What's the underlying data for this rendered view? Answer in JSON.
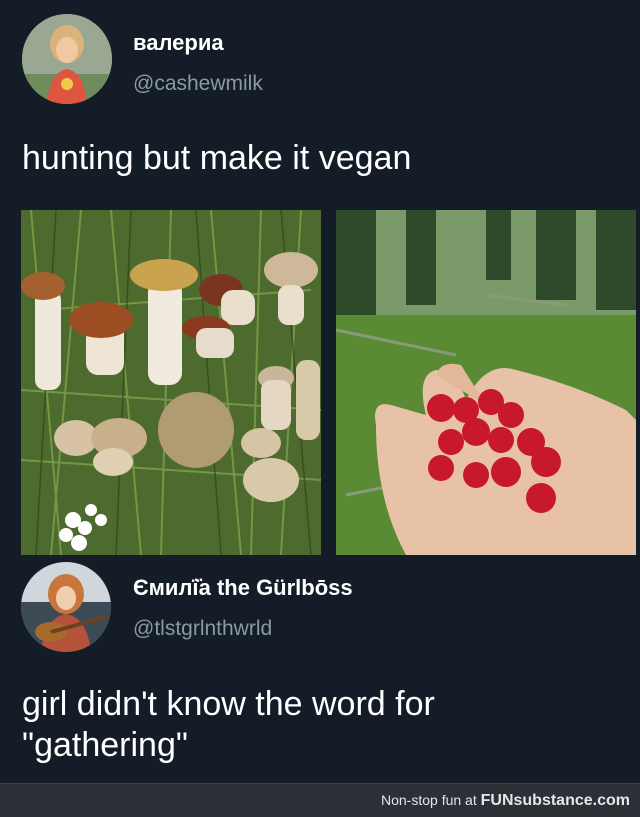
{
  "tweet1": {
    "display_name": "валериа",
    "handle": "@cashewmilk",
    "text": "hunting but make it vegan",
    "images": [
      "mushrooms-photo",
      "raspberries-photo"
    ]
  },
  "tweet2": {
    "display_name": "Ємилї̈а the Gürlbōss",
    "handle": "@tlstgrlnthwrld",
    "text_line1": "girl didn't know the word for",
    "text_line2": "\"gathering\""
  },
  "footer": {
    "prefix": "Non-stop fun at ",
    "brand": "FUNsubstance.com"
  },
  "colors": {
    "background": "#131c27",
    "handle": "#8b98a5",
    "footer": "#2b2f36"
  }
}
